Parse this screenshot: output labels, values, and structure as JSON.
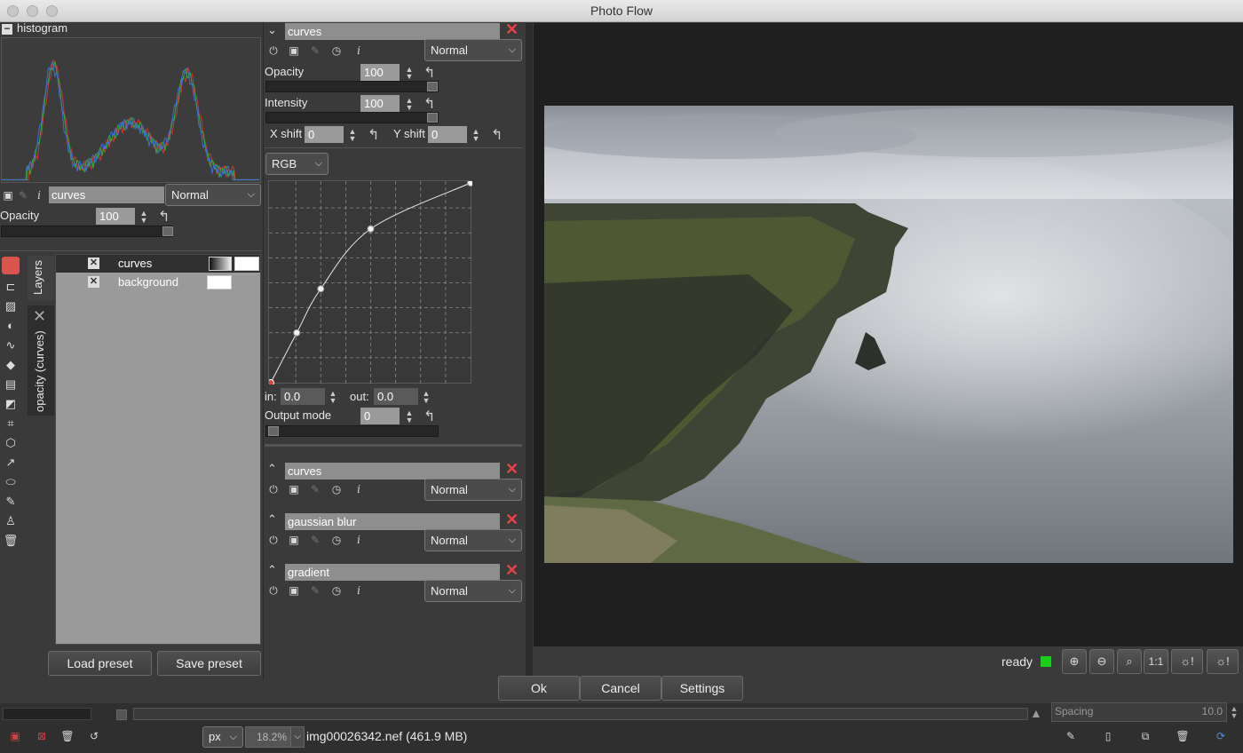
{
  "window": {
    "title": "Photo Flow"
  },
  "histogram": {
    "title": "histogram",
    "collapse": "−"
  },
  "layer_props": {
    "name": "curves",
    "blend": "Normal",
    "opacity_label": "Opacity",
    "opacity_value": "100"
  },
  "layers_panel": {
    "tab_layers": "Layers",
    "tab_opacity": "opacity (curves)",
    "rows": [
      {
        "name": "curves"
      },
      {
        "name": "background"
      }
    ],
    "load_preset": "Load preset",
    "save_preset": "Save preset"
  },
  "curves_panel": {
    "name": "curves",
    "blend": "Normal",
    "opacity_label": "Opacity",
    "opacity_value": "100",
    "intensity_label": "Intensity",
    "intensity_value": "100",
    "xshift_label": "X shift",
    "xshift_value": "0",
    "yshift_label": "Y shift",
    "yshift_value": "0",
    "channel": "RGB",
    "in_label": "in:",
    "in_value": "0.0",
    "out_label": "out:",
    "out_value": "0.0",
    "output_mode_label": "Output mode",
    "output_mode_value": "0",
    "curve_points": [
      [
        0,
        0
      ],
      [
        0.13,
        0.25
      ],
      [
        0.25,
        0.47
      ],
      [
        0.5,
        0.77
      ],
      [
        1,
        1
      ]
    ]
  },
  "collapsed_layers": [
    {
      "name": "curves",
      "blend": "Normal"
    },
    {
      "name": "gaussian blur",
      "blend": "Normal"
    },
    {
      "name": "gradient",
      "blend": "Normal"
    }
  ],
  "dialog": {
    "ok": "Ok",
    "cancel": "Cancel",
    "settings": "Settings"
  },
  "status": {
    "text": "ready",
    "color": "#19d019"
  },
  "zoom_buttons": [
    "zoom-in",
    "zoom-out",
    "zoom-fit",
    "1:1",
    "sun-warning",
    "sun-warning-2"
  ],
  "zoom_label_11": "1:1",
  "bottom": {
    "unit": "px",
    "zoom": "18.2%",
    "file": "img00026342.nef (461.9 MB)",
    "spacing_label": "Spacing",
    "spacing_value": "10.0"
  },
  "colors": {
    "accent_red": "#e34545",
    "panel": "#3a3a3a",
    "canvas": "#1f1f1f"
  }
}
